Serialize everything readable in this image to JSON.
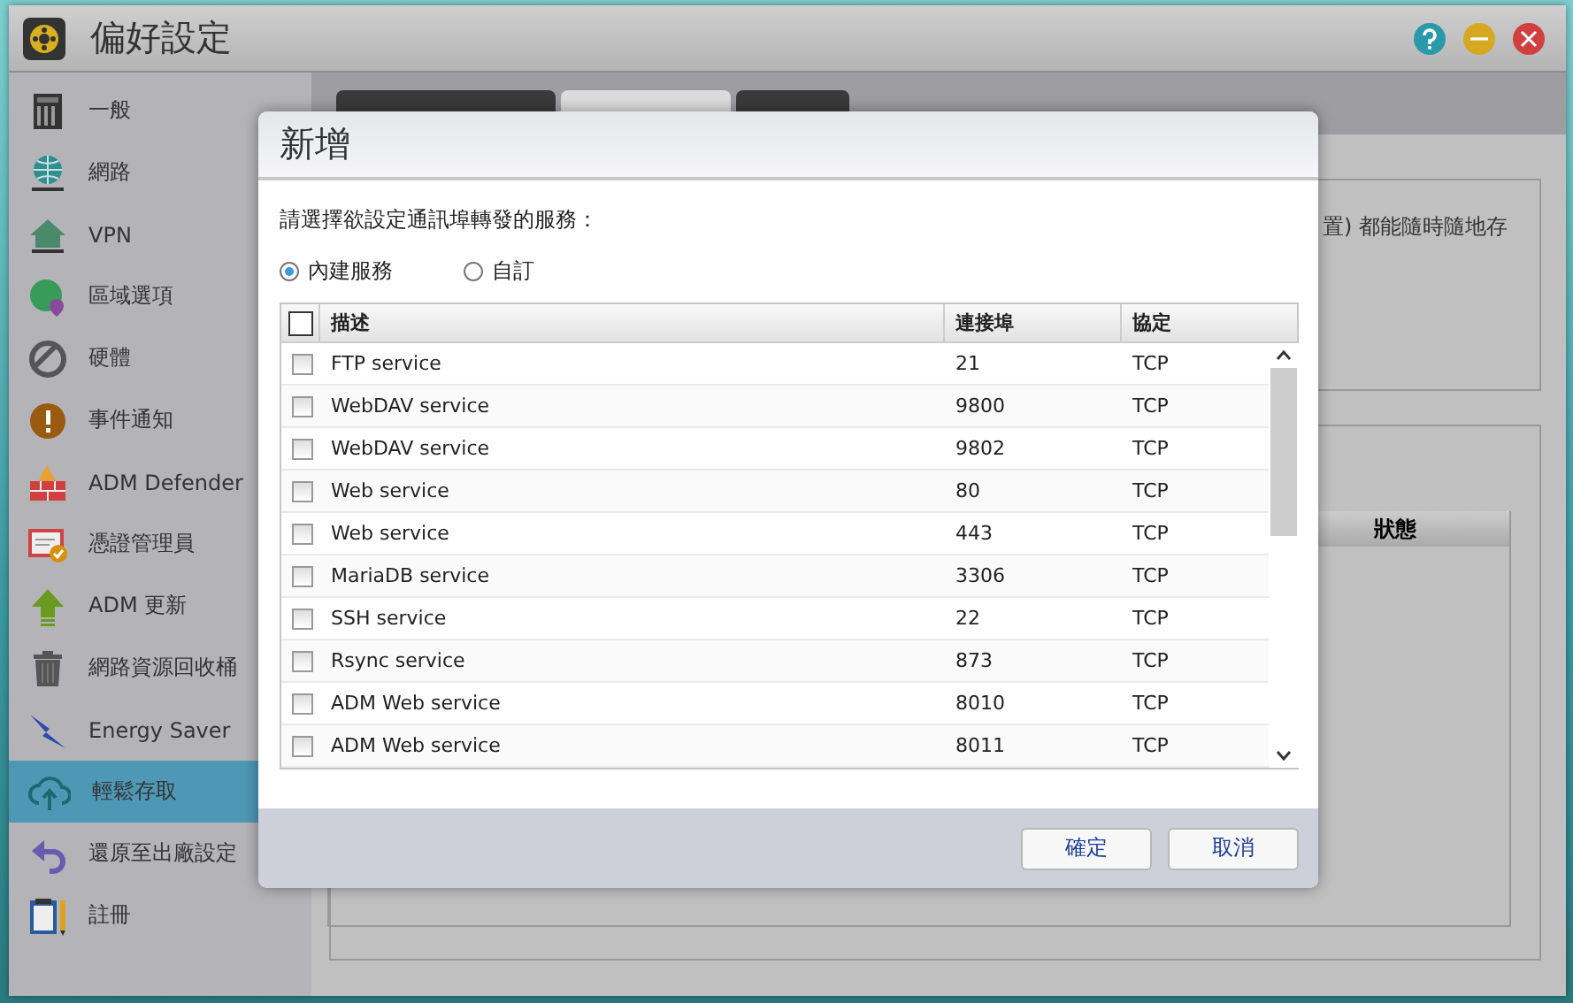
{
  "window": {
    "title": "偏好設定"
  },
  "sidebar": {
    "items": [
      {
        "label": "一般",
        "selected": false
      },
      {
        "label": "網路",
        "selected": false
      },
      {
        "label": "VPN",
        "selected": false
      },
      {
        "label": "區域選項",
        "selected": false
      },
      {
        "label": "硬體",
        "selected": false
      },
      {
        "label": "事件通知",
        "selected": false
      },
      {
        "label": "ADM Defender",
        "selected": false
      },
      {
        "label": "憑證管理員",
        "selected": false
      },
      {
        "label": "ADM 更新",
        "selected": false
      },
      {
        "label": "網路資源回收桶",
        "selected": false
      },
      {
        "label": "Energy Saver",
        "selected": false
      },
      {
        "label": "輕鬆存取",
        "selected": true
      },
      {
        "label": "還原至出廠設定",
        "selected": false
      },
      {
        "label": "註冊",
        "selected": false
      }
    ]
  },
  "tabs": [
    {
      "selected": false
    },
    {
      "selected": true
    },
    {
      "selected": false
    }
  ],
  "background": {
    "text": "置) 都能隨時隨地存",
    "column": "狀態"
  },
  "dialog": {
    "title": "新增",
    "prompt": "請選擇欲設定通訊埠轉發的服務：",
    "options": [
      {
        "label": "內建服務",
        "selected": true
      },
      {
        "label": "自訂",
        "selected": false
      }
    ],
    "table": {
      "all_checked": false,
      "columns": [
        "描述",
        "連接埠",
        "協定"
      ],
      "rows": [
        {
          "checked": false,
          "description": "FTP service",
          "port": "21",
          "protocol": "TCP"
        },
        {
          "checked": false,
          "description": "WebDAV service",
          "port": "9800",
          "protocol": "TCP"
        },
        {
          "checked": false,
          "description": "WebDAV service",
          "port": "9802",
          "protocol": "TCP"
        },
        {
          "checked": false,
          "description": "Web service",
          "port": "80",
          "protocol": "TCP"
        },
        {
          "checked": false,
          "description": "Web service",
          "port": "443",
          "protocol": "TCP"
        },
        {
          "checked": false,
          "description": "MariaDB service",
          "port": "3306",
          "protocol": "TCP"
        },
        {
          "checked": false,
          "description": "SSH service",
          "port": "22",
          "protocol": "TCP"
        },
        {
          "checked": false,
          "description": "Rsync service",
          "port": "873",
          "protocol": "TCP"
        },
        {
          "checked": false,
          "description": "ADM Web service",
          "port": "8010",
          "protocol": "TCP"
        },
        {
          "checked": false,
          "description": "ADM Web service",
          "port": "8011",
          "protocol": "TCP"
        }
      ]
    },
    "buttons": [
      "確定",
      "取消"
    ]
  }
}
